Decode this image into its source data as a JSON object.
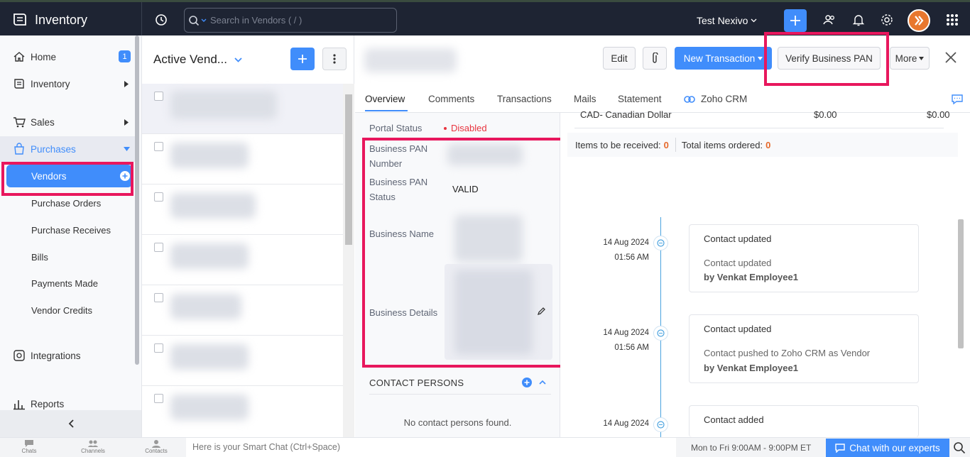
{
  "app": {
    "title": "Inventory",
    "org_name": "Test Nexivo"
  },
  "search": {
    "placeholder": "Search in Vendors ( / )"
  },
  "sidebar": {
    "home": "Home",
    "home_badge": "1",
    "inventory": "Inventory",
    "sales": "Sales",
    "purchases": "Purchases",
    "purchases_sub": [
      "Vendors",
      "Purchase Orders",
      "Purchase Receives",
      "Bills",
      "Payments Made",
      "Vendor Credits"
    ],
    "integrations": "Integrations",
    "reports": "Reports"
  },
  "list": {
    "title": "Active Vend..."
  },
  "header": {
    "edit": "Edit",
    "new_transaction": "New Transaction",
    "verify_pan": "Verify Business PAN",
    "more": "More"
  },
  "tabs": [
    "Overview",
    "Comments",
    "Transactions",
    "Mails",
    "Statement",
    "Zoho CRM"
  ],
  "overview": {
    "portal_status_label": "Portal Status",
    "portal_status_value": "Disabled",
    "pan_number_label": [
      "Business PAN",
      "Number"
    ],
    "pan_status_label": [
      "Business PAN",
      "Status"
    ],
    "pan_status_value": "VALID",
    "business_name_label": "Business Name",
    "business_details_label": "Business Details",
    "contact_persons_label": "CONTACT PERSONS",
    "no_contacts": "No contact persons found."
  },
  "currency_row": {
    "name": "CAD- Canadian Dollar",
    "amount1": "$0.00",
    "amount2": "$0.00"
  },
  "items": {
    "to_receive_label": "Items to be received:",
    "to_receive_value": "0",
    "total_ordered_label": "Total items ordered:",
    "total_ordered_value": "0"
  },
  "timeline": [
    {
      "date": "14 Aug 2024",
      "time": "01:56 AM",
      "title": "Contact updated",
      "desc": "Contact updated",
      "by": "by Venkat Employee1"
    },
    {
      "date": "14 Aug 2024",
      "time": "01:56 AM",
      "title": "Contact updated",
      "desc": "Contact pushed to Zoho CRM as Vendor",
      "by": "by Venkat Employee1"
    },
    {
      "date": "14 Aug 2024",
      "time": "",
      "title": "Contact added",
      "desc": "",
      "by": ""
    }
  ],
  "bottom": {
    "chats": "Chats",
    "channels": "Channels",
    "contacts": "Contacts",
    "smart_chat": "Here is your Smart Chat (Ctrl+Space)",
    "hours": "Mon to Fri 9:00AM - 9:00PM ET",
    "chat_experts": "Chat with our experts"
  },
  "colors": {
    "accent": "#408dfb",
    "topbar": "#1e2433",
    "highlight": "#e8175d",
    "disabled": "#e8343f"
  }
}
